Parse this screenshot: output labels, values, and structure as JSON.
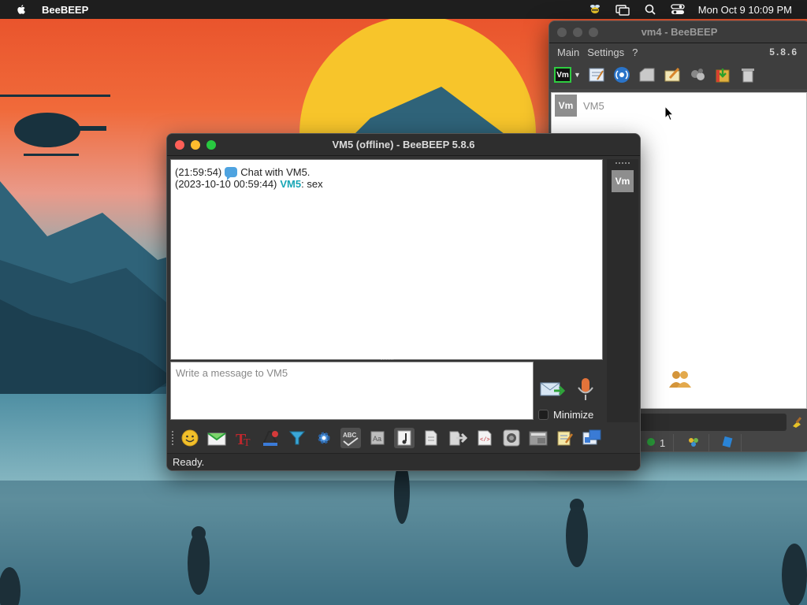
{
  "menubar": {
    "app_name": "BeeBEEP",
    "clock": "Mon Oct 9  10:09 PM",
    "icons": [
      "apple-icon",
      "beebeep-tray-icon",
      "screen-mirroring-icon",
      "spotlight-search-icon",
      "control-center-icon"
    ]
  },
  "vm4_window": {
    "title": "vm4 - BeeBEEP",
    "menu": [
      "Main",
      "Settings",
      "?"
    ],
    "version": "5.8.6",
    "status_badge": "Vm",
    "users": [
      {
        "avatar": "Vm",
        "name": "VM5"
      }
    ],
    "status_count": "1"
  },
  "chat_window": {
    "title": "VM5 (offline) - BeeBEEP 5.8.6",
    "messages": [
      {
        "time": "(21:59:54)",
        "user": "",
        "text": "Chat with VM5."
      },
      {
        "time": "(2023-10-10 00:59:44)",
        "user": "VM5",
        "text": ": sex"
      }
    ],
    "input_placeholder": "Write a message to VM5",
    "minimize_label": "Minimize",
    "side_avatar": "Vm",
    "status": "Ready."
  },
  "colors": {
    "accent_user": "#18a6b5",
    "window_bg": "#323232",
    "menubar_bg": "#1e1e1e"
  }
}
